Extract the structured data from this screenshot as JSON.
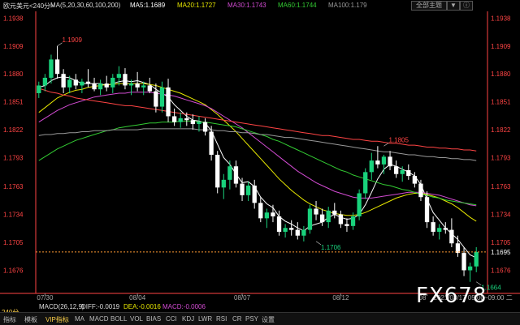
{
  "header": {
    "symbol": "欧元美元<240分>",
    "ma_title": "MA(5,20,30,60,100,200)",
    "ma_items": [
      {
        "label": "MA5:1.1689",
        "color": "#ffffff"
      },
      {
        "label": "MA20:1.1727",
        "color": "#e6e600"
      },
      {
        "label": "MA30:1.1743",
        "color": "#d24bd2"
      },
      {
        "label": "MA60:1.1744",
        "color": "#33cc33"
      },
      {
        "label": "MA100:1.179",
        "color": "#999999"
      }
    ],
    "buttons": [
      "全部主题",
      "▼",
      "ⓘ"
    ]
  },
  "macd": {
    "title": "MACD(26,12,9)",
    "diff": "DIFF:-0.0019",
    "dea": "DEA:-0.0016",
    "macd": "MACD:-0.0006"
  },
  "period_label": "240分",
  "bottom_tabs": [
    "指标",
    "模板",
    "VIP指标",
    "MA",
    "MACD",
    "BOLL",
    "VOL",
    "BIAS",
    "CCI",
    "KDJ",
    "LWR",
    "RSI",
    "CR",
    "PSY",
    "设置"
  ],
  "active_tab": "VIP指标",
  "watermark": "FX678",
  "colors": {
    "up": "#19d27c",
    "down": "#ffffff",
    "price_line": "#ff9933",
    "axis": "#ff4444",
    "annotation_max": "#ff4444",
    "annotation_min": "#19d27c"
  },
  "chart_data": {
    "type": "candlestick",
    "title": "",
    "ylim": [
      1.1652,
      1.1945
    ],
    "y_ticks": [
      1.1938,
      1.1909,
      1.188,
      1.1851,
      1.1822,
      1.1793,
      1.1763,
      1.1734,
      1.1705,
      1.1676
    ],
    "x_labels": [
      {
        "label": "07/30",
        "index": 1
      },
      {
        "label": "08/04",
        "index": 16
      },
      {
        "label": "08/07",
        "index": 33
      },
      {
        "label": "08/12",
        "index": 49
      },
      {
        "label": "08",
        "index": 63
      }
    ],
    "x_extra_label": "2021/08/17 05:00~09:00 二",
    "current_price": 1.1695,
    "annotations": [
      {
        "label": "1.1909",
        "index": 3,
        "price": 1.1909,
        "kind": "max"
      },
      {
        "label": "1.1805",
        "index": 56,
        "price": 1.1805,
        "kind": "max"
      },
      {
        "label": "1.1706",
        "index": 45,
        "price": 1.1706,
        "kind": "min"
      },
      {
        "label": "1.1664",
        "index": 71,
        "price": 1.1664,
        "kind": "min"
      }
    ],
    "candles": [
      [
        1.186,
        1.1872,
        1.1855,
        1.1868
      ],
      [
        1.1868,
        1.188,
        1.1862,
        1.1876
      ],
      [
        1.1876,
        1.19,
        1.187,
        1.1895
      ],
      [
        1.1895,
        1.1909,
        1.1875,
        1.188
      ],
      [
        1.188,
        1.1885,
        1.186,
        1.1866
      ],
      [
        1.1866,
        1.1878,
        1.186,
        1.1874
      ],
      [
        1.1874,
        1.188,
        1.1864,
        1.1868
      ],
      [
        1.1868,
        1.1875,
        1.186,
        1.1872
      ],
      [
        1.1872,
        1.1885,
        1.1866,
        1.187
      ],
      [
        1.187,
        1.1876,
        1.1862,
        1.1864
      ],
      [
        1.1864,
        1.1874,
        1.1858,
        1.187
      ],
      [
        1.187,
        1.1878,
        1.1862,
        1.1866
      ],
      [
        1.1866,
        1.188,
        1.186,
        1.1876
      ],
      [
        1.1876,
        1.1888,
        1.1868,
        1.188
      ],
      [
        1.188,
        1.1886,
        1.1864,
        1.1868
      ],
      [
        1.1868,
        1.1874,
        1.1858,
        1.187
      ],
      [
        1.187,
        1.1882,
        1.1862,
        1.1866
      ],
      [
        1.1866,
        1.1872,
        1.1858,
        1.1868
      ],
      [
        1.1868,
        1.1876,
        1.186,
        1.1862
      ],
      [
        1.1862,
        1.187,
        1.184,
        1.1846
      ],
      [
        1.1846,
        1.1872,
        1.184,
        1.1866
      ],
      [
        1.1866,
        1.1875,
        1.183,
        1.1836
      ],
      [
        1.1836,
        1.1844,
        1.1826,
        1.183
      ],
      [
        1.183,
        1.184,
        1.1824,
        1.1834
      ],
      [
        1.1834,
        1.184,
        1.1826,
        1.1832
      ],
      [
        1.1832,
        1.1838,
        1.1822,
        1.1828
      ],
      [
        1.1828,
        1.1836,
        1.182,
        1.183
      ],
      [
        1.183,
        1.1834,
        1.1816,
        1.182
      ],
      [
        1.182,
        1.1826,
        1.179,
        1.1796
      ],
      [
        1.1796,
        1.18,
        1.1756,
        1.1762
      ],
      [
        1.1762,
        1.1776,
        1.175,
        1.177
      ],
      [
        1.177,
        1.179,
        1.176,
        1.1784
      ],
      [
        1.1784,
        1.179,
        1.1762,
        1.1766
      ],
      [
        1.1766,
        1.1772,
        1.1748,
        1.1754
      ],
      [
        1.1754,
        1.1768,
        1.1748,
        1.1764
      ],
      [
        1.1764,
        1.177,
        1.174,
        1.1746
      ],
      [
        1.1746,
        1.1752,
        1.1726,
        1.173
      ],
      [
        1.173,
        1.174,
        1.172,
        1.1736
      ],
      [
        1.1736,
        1.1744,
        1.1726,
        1.1732
      ],
      [
        1.1732,
        1.1738,
        1.1712,
        1.1716
      ],
      [
        1.1716,
        1.1724,
        1.171,
        1.172
      ],
      [
        1.172,
        1.1728,
        1.1712,
        1.1718
      ],
      [
        1.1718,
        1.1726,
        1.1708,
        1.1712
      ],
      [
        1.1712,
        1.1722,
        1.1706,
        1.1718
      ],
      [
        1.1718,
        1.1744,
        1.1714,
        1.174
      ],
      [
        1.174,
        1.1748,
        1.1728,
        1.1734
      ],
      [
        1.1734,
        1.174,
        1.1722,
        1.1726
      ],
      [
        1.1726,
        1.1742,
        1.172,
        1.1738
      ],
      [
        1.1738,
        1.1746,
        1.173,
        1.1734
      ],
      [
        1.1734,
        1.1738,
        1.172,
        1.1724
      ],
      [
        1.1724,
        1.173,
        1.1716,
        1.1722
      ],
      [
        1.1722,
        1.1736,
        1.1718,
        1.1732
      ],
      [
        1.1732,
        1.176,
        1.1728,
        1.1756
      ],
      [
        1.1756,
        1.1782,
        1.175,
        1.1778
      ],
      [
        1.1778,
        1.1798,
        1.177,
        1.179
      ],
      [
        1.179,
        1.1805,
        1.1782,
        1.1786
      ],
      [
        1.1786,
        1.1796,
        1.1776,
        1.1794
      ],
      [
        1.1794,
        1.18,
        1.178,
        1.1784
      ],
      [
        1.1784,
        1.179,
        1.1772,
        1.1776
      ],
      [
        1.1776,
        1.1784,
        1.1768,
        1.178
      ],
      [
        1.178,
        1.1786,
        1.177,
        1.1774
      ],
      [
        1.1774,
        1.1778,
        1.1762,
        1.1766
      ],
      [
        1.1766,
        1.177,
        1.1748,
        1.1752
      ],
      [
        1.1752,
        1.1758,
        1.172,
        1.1726
      ],
      [
        1.1726,
        1.1732,
        1.1712,
        1.1716
      ],
      [
        1.1716,
        1.1724,
        1.1708,
        1.172
      ],
      [
        1.172,
        1.1726,
        1.1714,
        1.1718
      ],
      [
        1.1718,
        1.173,
        1.17,
        1.1704
      ],
      [
        1.1704,
        1.1712,
        1.169,
        1.1694
      ],
      [
        1.1694,
        1.17,
        1.167,
        1.1676
      ],
      [
        1.1676,
        1.1684,
        1.1664,
        1.168
      ],
      [
        1.168,
        1.17,
        1.1674,
        1.1695
      ]
    ],
    "ma_series": [
      {
        "name": "MA5",
        "color": "#ffffff",
        "values": [
          1.1866,
          1.1868,
          1.1873,
          1.1876,
          1.1877,
          1.1876,
          1.1873,
          1.187,
          1.187,
          1.187,
          1.187,
          1.1868,
          1.187,
          1.1872,
          1.1873,
          1.1872,
          1.1873,
          1.1871,
          1.1869,
          1.1864,
          1.186,
          1.1856,
          1.1848,
          1.1842,
          1.1836,
          1.1832,
          1.1831,
          1.1829,
          1.1821,
          1.1807,
          1.1793,
          1.1786,
          1.1776,
          1.1767,
          1.1768,
          1.1763,
          1.1752,
          1.1745,
          1.1741,
          1.1732,
          1.1727,
          1.1724,
          1.172,
          1.1717,
          1.1722,
          1.1724,
          1.1726,
          1.1731,
          1.1734,
          1.1731,
          1.1729,
          1.173,
          1.1734,
          1.1744,
          1.1757,
          1.1771,
          1.1781,
          1.1786,
          1.1784,
          1.1781,
          1.1778,
          1.1774,
          1.1765,
          1.175,
          1.1736,
          1.1728,
          1.172,
          1.1714,
          1.1708,
          1.17,
          1.1692,
          1.1689
        ]
      },
      {
        "name": "MA20",
        "color": "#e6e600",
        "values": [
          1.184,
          1.1845,
          1.185,
          1.1855,
          1.1858,
          1.1861,
          1.1863,
          1.1864,
          1.1866,
          1.1867,
          1.1868,
          1.1869,
          1.1869,
          1.187,
          1.187,
          1.187,
          1.187,
          1.187,
          1.1869,
          1.1868,
          1.1866,
          1.1864,
          1.1862,
          1.186,
          1.1857,
          1.1854,
          1.1851,
          1.1848,
          1.1843,
          1.1838,
          1.1832,
          1.1826,
          1.182,
          1.1813,
          1.1806,
          1.1799,
          1.1792,
          1.1785,
          1.1778,
          1.1771,
          1.1765,
          1.1759,
          1.1754,
          1.1749,
          1.1745,
          1.1742,
          1.1739,
          1.1737,
          1.1735,
          1.1734,
          1.1733,
          1.1733,
          1.1734,
          1.1736,
          1.1739,
          1.1742,
          1.1745,
          1.1748,
          1.1751,
          1.1753,
          1.1755,
          1.1756,
          1.1756,
          1.1755,
          1.1753,
          1.1751,
          1.1748,
          1.1745,
          1.1741,
          1.1736,
          1.1731,
          1.1727
        ]
      },
      {
        "name": "MA30",
        "color": "#d24bd2",
        "values": [
          1.183,
          1.1834,
          1.1838,
          1.1842,
          1.1845,
          1.1848,
          1.185,
          1.1852,
          1.1854,
          1.1856,
          1.1857,
          1.1858,
          1.1859,
          1.186,
          1.186,
          1.1861,
          1.1861,
          1.1861,
          1.1861,
          1.186,
          1.1859,
          1.1858,
          1.1857,
          1.1855,
          1.1853,
          1.1851,
          1.1849,
          1.1847,
          1.1844,
          1.184,
          1.1836,
          1.1832,
          1.1828,
          1.1824,
          1.1819,
          1.1814,
          1.1809,
          1.1804,
          1.1799,
          1.1794,
          1.1789,
          1.1784,
          1.1779,
          1.1775,
          1.1771,
          1.1767,
          1.1764,
          1.1761,
          1.1758,
          1.1756,
          1.1754,
          1.1752,
          1.1751,
          1.1751,
          1.1751,
          1.1752,
          1.1753,
          1.1754,
          1.1755,
          1.1756,
          1.1757,
          1.1757,
          1.1757,
          1.1756,
          1.1755,
          1.1754,
          1.1752,
          1.175,
          1.1748,
          1.1746,
          1.1744,
          1.1743
        ]
      },
      {
        "name": "MA60",
        "color": "#33cc33",
        "values": [
          1.179,
          1.1794,
          1.1798,
          1.1802,
          1.1805,
          1.1808,
          1.1811,
          1.1813,
          1.1815,
          1.1817,
          1.1819,
          1.1821,
          1.1822,
          1.1824,
          1.1825,
          1.1826,
          1.1827,
          1.1828,
          1.1829,
          1.1829,
          1.183,
          1.183,
          1.183,
          1.1831,
          1.1831,
          1.1831,
          1.183,
          1.183,
          1.1829,
          1.1828,
          1.1827,
          1.1826,
          1.1825,
          1.1823,
          1.1821,
          1.1819,
          1.1817,
          1.1815,
          1.1812,
          1.181,
          1.1807,
          1.1804,
          1.1801,
          1.1798,
          1.1795,
          1.1792,
          1.1789,
          1.1786,
          1.1783,
          1.178,
          1.1778,
          1.1775,
          1.1773,
          1.1771,
          1.1769,
          1.1767,
          1.1765,
          1.1764,
          1.1762,
          1.176,
          1.1759,
          1.1757,
          1.1755,
          1.1754,
          1.1752,
          1.1751,
          1.1749,
          1.1748,
          1.1747,
          1.1746,
          1.1745,
          1.1744
        ]
      },
      {
        "name": "MA100",
        "color": "#999999",
        "values": [
          1.1816,
          1.1817,
          1.1817,
          1.1818,
          1.1818,
          1.1819,
          1.1819,
          1.182,
          1.182,
          1.1821,
          1.1821,
          1.1821,
          1.1822,
          1.1822,
          1.1822,
          1.1822,
          1.1822,
          1.1823,
          1.1823,
          1.1823,
          1.1823,
          1.1823,
          1.1823,
          1.1823,
          1.1823,
          1.1823,
          1.1822,
          1.1822,
          1.1822,
          1.1821,
          1.1821,
          1.182,
          1.182,
          1.1819,
          1.1819,
          1.1818,
          1.1817,
          1.1817,
          1.1816,
          1.1815,
          1.1814,
          1.1814,
          1.1813,
          1.1812,
          1.1811,
          1.181,
          1.1809,
          1.1808,
          1.1807,
          1.1806,
          1.1805,
          1.1804,
          1.1803,
          1.1802,
          1.1801,
          1.18,
          1.1799,
          1.1799,
          1.1798,
          1.1797,
          1.1796,
          1.1796,
          1.1795,
          1.1794,
          1.1794,
          1.1793,
          1.1793,
          1.1792,
          1.1792,
          1.1791,
          1.1791,
          1.179
        ]
      },
      {
        "name": "MA200",
        "color": "#ff4444",
        "values": [
          1.1865,
          1.1863,
          1.1861,
          1.186,
          1.1858,
          1.1857,
          1.1855,
          1.1854,
          1.1853,
          1.1852,
          1.1851,
          1.185,
          1.1849,
          1.1848,
          1.1847,
          1.1847,
          1.1846,
          1.1845,
          1.1844,
          1.1843,
          1.1842,
          1.1841,
          1.184,
          1.1839,
          1.1838,
          1.1837,
          1.1836,
          1.1835,
          1.1834,
          1.1833,
          1.1832,
          1.1831,
          1.183,
          1.1829,
          1.1828,
          1.1827,
          1.1826,
          1.1825,
          1.1824,
          1.1823,
          1.1822,
          1.1821,
          1.182,
          1.1819,
          1.1818,
          1.1817,
          1.1816,
          1.1816,
          1.1815,
          1.1814,
          1.1813,
          1.1812,
          1.1812,
          1.1811,
          1.181,
          1.181,
          1.1809,
          1.1808,
          1.1808,
          1.1807,
          1.1806,
          1.1806,
          1.1805,
          1.1804,
          1.1804,
          1.1803,
          1.1803,
          1.1802,
          1.1802,
          1.1801,
          1.1801,
          1.18
        ]
      }
    ]
  }
}
